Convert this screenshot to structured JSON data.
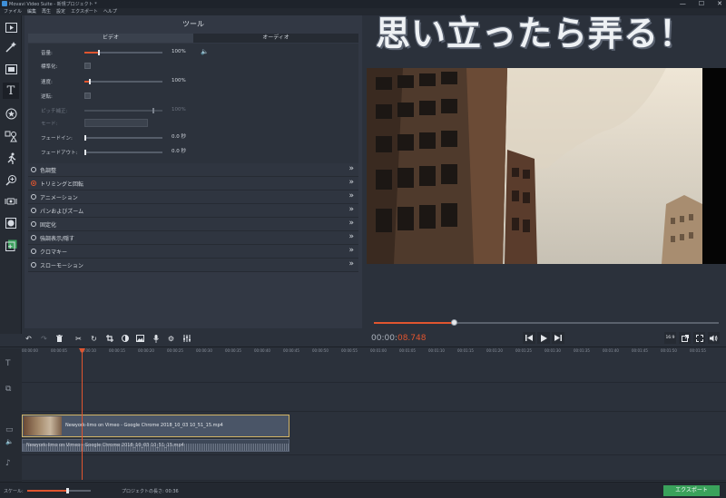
{
  "window": {
    "title": "Movavi Video Suite - 新規プロジェクト *",
    "controls": [
      "—",
      "☐",
      "✕"
    ]
  },
  "menu": [
    "ファイル",
    "編集",
    "再生",
    "設定",
    "エクスポート",
    "ヘルプ"
  ],
  "overlay_caption": "思い立ったら弄る！",
  "tools_panel": {
    "title": "ツール",
    "tabs": [
      "ビデオ",
      "オーディオ"
    ],
    "properties": {
      "volume": {
        "label": "音量:",
        "value": "100%",
        "level": 0.2
      },
      "normalize": {
        "label": "標準化:"
      },
      "speed": {
        "label": "速度:",
        "value": "100%",
        "level": 0.08
      },
      "reverse": {
        "label": "逆転:"
      },
      "pitch": {
        "label": "ピッチ補正:",
        "value": "100%",
        "level": 0.9
      },
      "mode": {
        "label": "モード:"
      },
      "fade_in": {
        "label": "フェードイン:",
        "value": "0.0 秒"
      },
      "fade_out": {
        "label": "フェードアウト:",
        "value": "0.0 秒"
      }
    },
    "sections": [
      {
        "name": "色調整",
        "active": false
      },
      {
        "name": "トリミングと回転",
        "active": true
      },
      {
        "name": "アニメーション",
        "active": false
      },
      {
        "name": "パンおよびズーム",
        "active": false
      },
      {
        "name": "固定化",
        "active": false
      },
      {
        "name": "強調表示/隠す",
        "active": false
      },
      {
        "name": "クロマキー",
        "active": false
      },
      {
        "name": "スローモーション",
        "active": false
      }
    ]
  },
  "player": {
    "timecode_prefix": "00:00:",
    "timecode_highlight": "08.748",
    "progress": 0.23,
    "aspect_ratio": "16:9"
  },
  "timeline": {
    "ruler": [
      "00:00:00",
      "00:00:05",
      "00:00:10",
      "00:00:15",
      "00:00:20",
      "00:00:25",
      "00:00:30",
      "00:00:35",
      "00:00:40",
      "00:00:45",
      "00:00:50",
      "00:00:55",
      "00:01:00",
      "00:01:05",
      "00:01:10",
      "00:01:15",
      "00:01:20",
      "00:01:25",
      "00:01:30",
      "00:01:35",
      "00:01:40",
      "00:01:45",
      "00:01:50",
      "00:01:55"
    ],
    "video_clip": "Newyork-limo on Vimeo - Google Chrome 2018_10_03 10_51_15.mp4",
    "audio_clip": "Newyork-limo on Vimeo - Google Chrome 2018_10_03 10_51_15.mp4"
  },
  "status": {
    "scale_label": "スケール:",
    "duration_label": "プロジェクトの長さ: 00:36",
    "export_label": "エクスポート"
  },
  "colors": {
    "accent": "#e0552f",
    "export_green": "#3aa25b",
    "clip_border": "#d2b466"
  }
}
